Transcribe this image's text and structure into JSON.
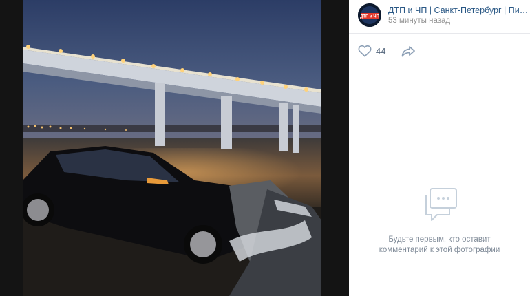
{
  "post": {
    "author": "ДТП и ЧП | Санкт-Петербург | Питер Онлайн | СПб",
    "time": "53 минуты назад",
    "avatar_text": "ДТП и ЧП"
  },
  "actions": {
    "likes": "44",
    "like_icon": "heart-icon",
    "share_icon": "share-icon"
  },
  "comments": {
    "empty_line1": "Будьте первым, кто оставит",
    "empty_line2": "комментарий к этой фотографии",
    "empty_icon": "comment-bubble-icon"
  },
  "colors": {
    "link": "#2a5885",
    "muted": "#939393",
    "accent_icon": "#8da0b6"
  }
}
